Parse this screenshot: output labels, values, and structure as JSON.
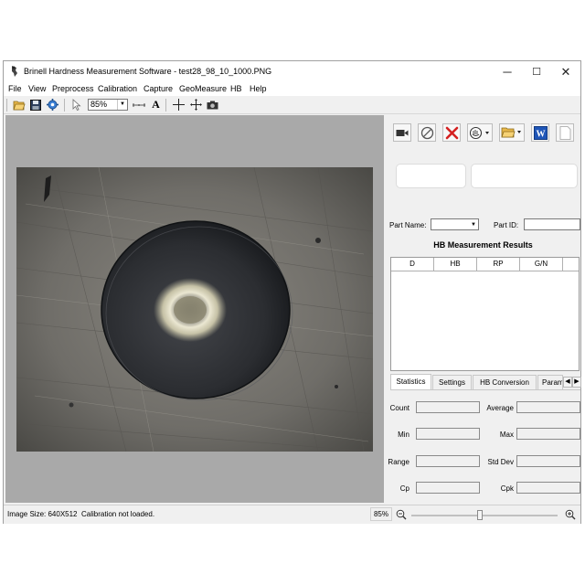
{
  "window": {
    "title": "Brinell Hardness Measurement Software - test28_98_10_1000.PNG",
    "controls": {
      "minimize": "─",
      "maximize": "☐",
      "close": "✕"
    }
  },
  "menu": [
    "File",
    "View",
    "Preprocess",
    "Calibration",
    "Capture",
    "GeoMeasure",
    "HB",
    "Help"
  ],
  "toolbar": {
    "icons": [
      "open-folder-icon",
      "save-icon",
      "settings-gear-icon",
      "pointer-icon",
      "zoom-select",
      "ruler-icon",
      "text-icon",
      "crosshair-icon",
      "move-icon",
      "camera-icon"
    ],
    "zoom_value": "85%"
  },
  "right_panel": {
    "buttons": [
      "video-camera-icon",
      "no-entry-icon",
      "delete-x-icon",
      "measure-hand-icon",
      "open-folder-icon",
      "word-report-icon",
      "blank-page-icon"
    ],
    "part_name_label": "Part Name:",
    "part_id_label": "Part ID:",
    "results_title": "HB Measurement Results",
    "columns": [
      "D",
      "HB",
      "RP",
      "G/N"
    ],
    "tabs": [
      "Statistics",
      "Settings",
      "HB Conversion",
      "Param"
    ],
    "active_tab": "Statistics",
    "stats": {
      "count": "Count",
      "average": "Average",
      "min": "Min",
      "max": "Max",
      "range": "Range",
      "std_dev": "Std Dev",
      "cp": "Cp",
      "cpk": "Cpk"
    }
  },
  "status": {
    "image_size": "Image Size: 640X512",
    "calibration": "Calibration not loaded.",
    "zoom": "85%",
    "zoom_slider_fraction": 0.47
  },
  "colors": {
    "workspace": "#a9a9a9",
    "panel": "#f0f0f0",
    "delete_red": "#d42020",
    "word_blue": "#1f56b8"
  }
}
